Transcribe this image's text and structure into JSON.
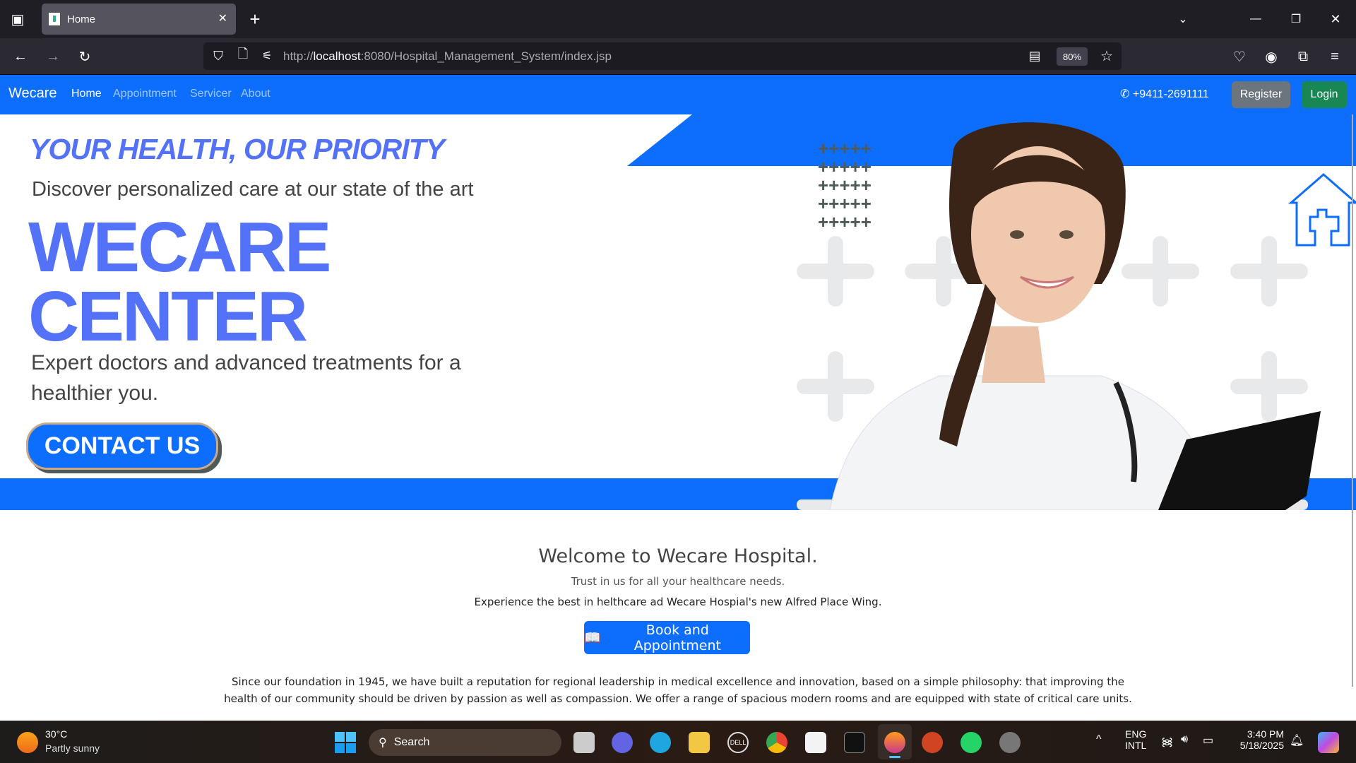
{
  "browser": {
    "tab_title": "Home",
    "url_prefix": "http://",
    "url_host": "localhost",
    "url_rest": ":8080/Hospital_Management_System/index.jsp",
    "zoom": "80%"
  },
  "nav": {
    "brand": "Wecare",
    "links": [
      "Home",
      "Appointment",
      "Servicer",
      "About"
    ],
    "phone": "+9411-2691111",
    "register": "Register",
    "login": "Login"
  },
  "hero": {
    "tagline": "YOUR HEALTH, OUR PRIORITY",
    "subtitle": "Discover personalized care at our state of the art",
    "title_line1": "WECARE",
    "title_line2": "CENTER",
    "description": "Expert doctors and advanced treatments for a healthier you.",
    "cta": "CONTACT US"
  },
  "welcome": {
    "heading": "Welcome to Wecare Hospital.",
    "lead": "Trust in us for all your healthcare needs.",
    "line": "Experience the best in helthcare ad Wecare Hospial's new Alfred Place Wing.",
    "button": "Book and Appointment",
    "paragraph": "Since our foundation in 1945, we have built a reputation for regional leadership in medical excellence and innovation, based on a simple philosophy: that improving the health of our community should be driven by passion as well as compassion. We offer a range of spacious modern rooms and are equipped with state of critical care units."
  },
  "taskbar": {
    "temp": "30°C",
    "weather": "Partly sunny",
    "search": "Search",
    "lang1": "ENG",
    "lang2": "INTL",
    "time": "3:40 PM",
    "date": "5/18/2025"
  },
  "colors": {
    "primary": "#0d6efd",
    "accent": "#5372f7",
    "success": "#198754",
    "secondary": "#6c757d"
  }
}
